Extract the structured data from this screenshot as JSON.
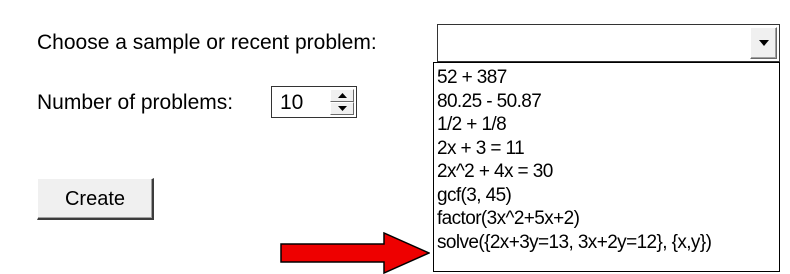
{
  "form": {
    "sample_label": "Choose a sample or recent problem:",
    "selected_problem": "",
    "count_label": "Number of problems:",
    "count_value": "10",
    "create_label": "Create"
  },
  "dropdown": {
    "items": [
      "52 + 387",
      "80.25 - 50.87",
      "1/2 + 1/8",
      "2x + 3 = 11",
      "2x^2 + 4x = 30",
      "gcf(3, 45)",
      "factor(3x^2+5x+2)",
      "solve({2x+3y=13, 3x+2y=12}, {x,y})"
    ]
  },
  "icons": {
    "combo_arrow": "chevron-down-icon",
    "spin_up": "triangle-up-icon",
    "spin_down": "triangle-down-icon",
    "annotation": "red-arrow-icon"
  },
  "colors": {
    "annotation_arrow": "#ee0000"
  }
}
